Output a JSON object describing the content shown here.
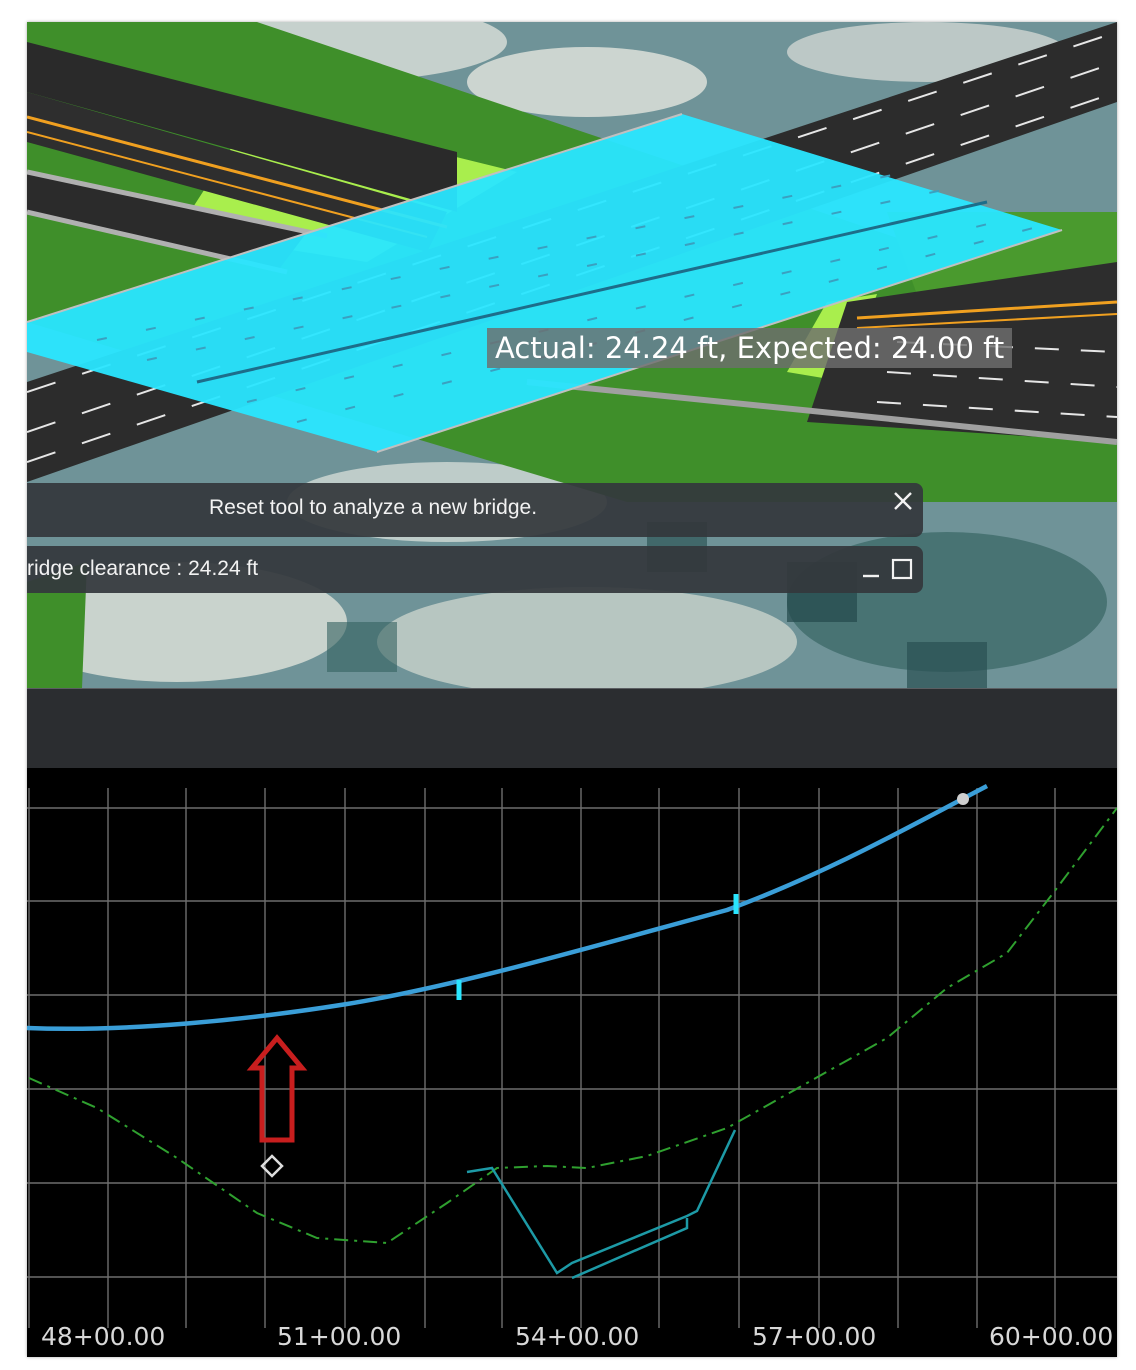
{
  "viewport": {
    "measurement_label": "Actual: 24.24 ft, Expected: 24.00 ft"
  },
  "notification": {
    "message": "Reset tool to analyze a new bridge.",
    "close_icon": "close-icon"
  },
  "result_panel": {
    "text": "ridge clearance : 24.24 ft",
    "minimize_icon": "minimize-icon",
    "maximize_icon": "maximize-icon"
  },
  "profile_view": {
    "station_labels": [
      "48+00.00",
      "51+00.00",
      "54+00.00",
      "57+00.00",
      "60+00.00"
    ],
    "colors": {
      "background": "#000000",
      "grid": "#6e6e6e",
      "bridge_profile": "#3a9ed8",
      "ground_line": "#2fa02f",
      "channel": "#1d9aa6",
      "arrow": "#c81e1e",
      "bridge_deck": "#29e6ff"
    }
  }
}
